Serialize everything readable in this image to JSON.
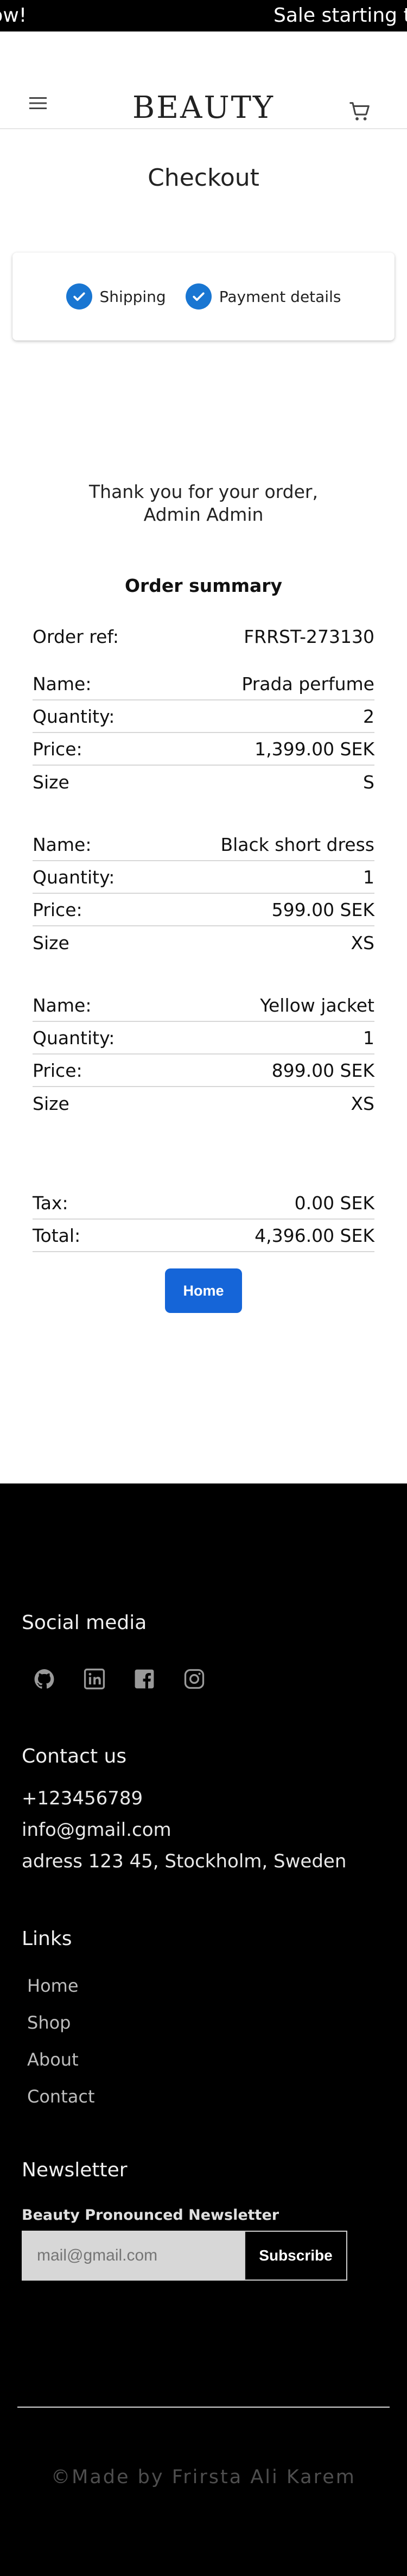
{
  "announcement": {
    "left_text": "omorrow!",
    "right_text": "Sale starting to"
  },
  "header": {
    "brand": "BEAUTY",
    "menu_icon": "hamburger-icon",
    "cart_icon": "cart-icon"
  },
  "checkout": {
    "title": "Checkout",
    "steps": [
      {
        "label": "Shipping"
      },
      {
        "label": "Payment details"
      }
    ],
    "thanks_line1": "Thank you for your order,",
    "thanks_line2": "Admin Admin",
    "summary_title": "Order summary",
    "order_ref_label": "Order ref:",
    "order_ref": "FRRST-273130",
    "items": [
      {
        "name_label": "Name:",
        "name": "Prada perfume",
        "quantity_label": "Quantity:",
        "quantity": "2",
        "price_label": "Price:",
        "price": "1,399.00 SEK",
        "size_label": "Size",
        "size": "S"
      },
      {
        "name_label": "Name:",
        "name": "Black short dress",
        "quantity_label": "Quantity:",
        "quantity": "1",
        "price_label": "Price:",
        "price": "599.00 SEK",
        "size_label": "Size",
        "size": "XS"
      },
      {
        "name_label": "Name:",
        "name": "Yellow jacket",
        "quantity_label": "Quantity:",
        "quantity": "1",
        "price_label": "Price:",
        "price": "899.00 SEK",
        "size_label": "Size",
        "size": "XS"
      }
    ],
    "tax_label": "Tax:",
    "tax": "0.00 SEK",
    "total_label": "Total:",
    "total": "4,396.00 SEK",
    "home_button": "Home"
  },
  "footer": {
    "social_title": "Social media",
    "social_icons": [
      "github-icon",
      "linkedin-icon",
      "facebook-icon",
      "instagram-icon"
    ],
    "contact_title": "Contact us",
    "phone": "+123456789",
    "email": "info@gmail.com",
    "address": "adress 123 45, Stockholm, Sweden",
    "links_title": "Links",
    "links": [
      "Home",
      "Shop",
      "About",
      "Contact"
    ],
    "newsletter_title": "Newsletter",
    "newsletter_label": "Beauty Pronounced Newsletter",
    "newsletter_placeholder": "mail@gmail.com",
    "subscribe_label": "Subscribe",
    "credit": "©Made by Frirsta Ali Karem"
  },
  "colors": {
    "accent": "#1976d2",
    "button": "#1565d8",
    "footer_bg": "#000000"
  }
}
